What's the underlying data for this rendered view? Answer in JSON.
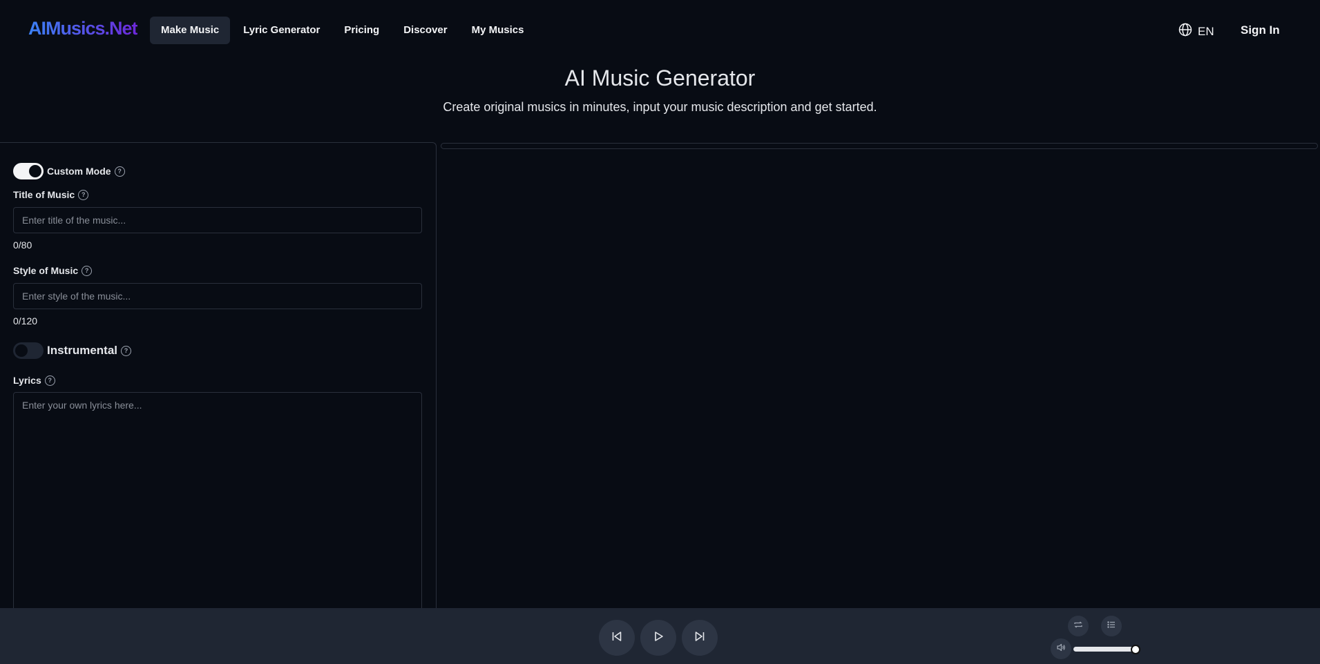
{
  "header": {
    "logo": "AIMusics.Net",
    "nav": [
      {
        "label": "Make Music",
        "active": true
      },
      {
        "label": "Lyric Generator",
        "active": false
      },
      {
        "label": "Pricing",
        "active": false
      },
      {
        "label": "Discover",
        "active": false
      },
      {
        "label": "My Musics",
        "active": false
      }
    ],
    "language": "EN",
    "sign_in": "Sign In"
  },
  "hero": {
    "title": "AI Music Generator",
    "subtitle": "Create original musics in minutes, input your music description and get started."
  },
  "form": {
    "custom_mode": {
      "label": "Custom Mode",
      "on": true
    },
    "title": {
      "label": "Title of Music",
      "placeholder": "Enter title of the music...",
      "value": "",
      "counter": "0/80"
    },
    "style": {
      "label": "Style of Music",
      "placeholder": "Enter style of the music...",
      "value": "",
      "counter": "0/120"
    },
    "instrumental": {
      "label": "Instrumental",
      "on": false
    },
    "lyrics": {
      "label": "Lyrics",
      "placeholder": "Enter your own lyrics here...",
      "value": ""
    }
  },
  "player": {
    "icons": [
      "skip-back-icon",
      "play-icon",
      "skip-forward-icon",
      "repeat-icon",
      "playlist-icon",
      "volume-icon"
    ],
    "volume_fraction": 1.0
  },
  "colors": {
    "background": "#080c14",
    "panel": "#1f2633",
    "logo_gradient_start": "#3b82f6",
    "logo_gradient_end": "#6d28d9"
  }
}
